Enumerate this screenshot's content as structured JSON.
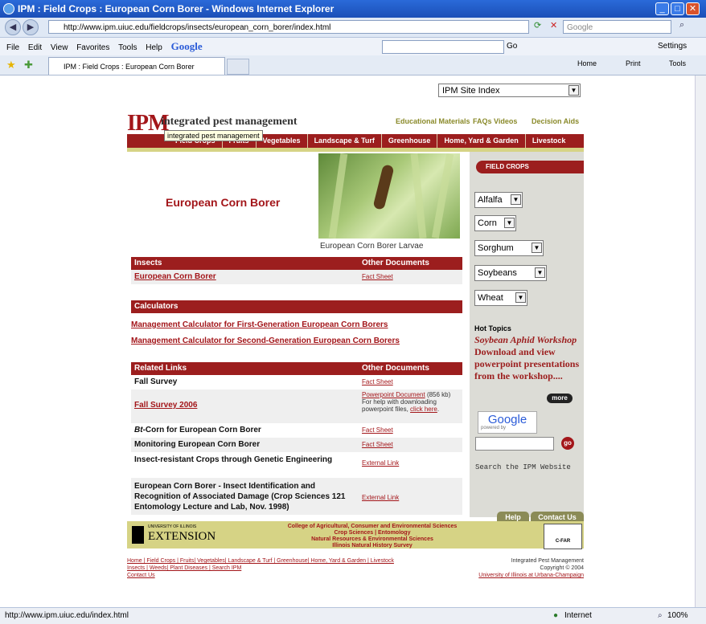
{
  "window": {
    "title": "IPM : Field Crops : European Corn Borer - Windows Internet Explorer"
  },
  "address": {
    "url": "http://www.ipm.uiuc.edu/fieldcrops/insects/european_corn_borer/index.html",
    "search_placeholder": "Google"
  },
  "menu": [
    "File",
    "Edit",
    "View",
    "Favorites",
    "Tools",
    "Help"
  ],
  "google_toolbar": {
    "label": "Google",
    "go": "Go"
  },
  "settings_label": "Settings",
  "tab": {
    "title": "IPM : Field Crops : European Corn Borer"
  },
  "tab_tools": [
    "Home",
    "Print",
    "Tools"
  ],
  "site_index": "IPM Site Index",
  "logo": {
    "mark": "IPM",
    "text": "integrated pest management"
  },
  "top_links": [
    "Educational Materials",
    "FAQs",
    "Videos",
    "Decision Aids"
  ],
  "nav_tabs": [
    "Field Crops",
    "Fruits",
    "Vegetables",
    "Landscape & Turf",
    "Greenhouse",
    "Home, Yard & Garden",
    "Livestock"
  ],
  "tooltip": "integrated pest management",
  "page_title": "European Corn Borer",
  "photo_caption": "European Corn Borer Larvae",
  "sidebar": {
    "banner": "FIELD CROPS",
    "crops": [
      "Alfalfa",
      "Corn",
      "Sorghum",
      "Soybeans",
      "Wheat"
    ],
    "hot_topics_title": "Hot Topics",
    "hot_topics_italic": "Soybean Aphid Workshop",
    "hot_topics_body": "Download and view powerpoint presentations from the workshop....",
    "more": "more",
    "google": "Google",
    "powered_by": "powered by",
    "go": "go",
    "search_label": "Search the IPM Website",
    "help": "Help",
    "contact": "Contact Us"
  },
  "insects_table": {
    "h1": "Insects",
    "h2": "Other Documents",
    "rows": [
      {
        "name": "European Corn Borer",
        "doc": "Fact Sheet"
      }
    ]
  },
  "calculators": {
    "title": "Calculators",
    "items": [
      "Management Calculator for First-Generation European Corn Borers",
      "Management Calculator for Second-Generation European Corn Borers"
    ]
  },
  "related": {
    "h1": "Related Links",
    "h2": "Other Documents",
    "rows": [
      {
        "name": "Fall Survey",
        "doc": "Fact Sheet"
      },
      {
        "name": "Fall Survey 2006",
        "doc": "Powerpoint Document",
        "doc_extra": " (856 kb)",
        "note": "For help with downloading powerpoint files,",
        "note_link": "click here",
        "note_end": "."
      },
      {
        "name_italic": "Bt",
        "name": "-Corn for European Corn Borer",
        "doc": "Fact Sheet"
      },
      {
        "name": "Monitoring European Corn Borer",
        "doc": "Fact Sheet"
      },
      {
        "name": "Insect-resistant Crops through Genetic Engineering",
        "doc": "External Link"
      },
      {
        "name": "European Corn Borer - Insect Identification and Recognition of Associated Damage (Crop Sciences 121 Entomology Lecture and Lab, Nov. 1998)",
        "doc": "External Link"
      }
    ]
  },
  "footer": {
    "ext_small": "UNIVERSITY OF ILLINOIS",
    "ext_big": "EXTENSION",
    "college": "College of Agricultural, Consumer and Environmental Sciences",
    "line2a": "Crop Sciences",
    "line2b": "Entomology",
    "line3": "Natural Resources & Environmental Sciences",
    "line4": "Illinois Natural History Survey",
    "cfar": "C-FAR",
    "bottom_links_1": "Home | Field Crops | Fruits| Vegetables| Landscape & Turf | Greenhouse| Home, Yard & Garden | Livestock",
    "bottom_links_2": "Insects | Weeds| Plant Diseases | Search IPM",
    "bottom_links_3": "Contact Us",
    "copy1": "Integrated Pest Management",
    "copy2": "Copyright © 2004",
    "copy3": "University of Illinois at Urbana-Champaign"
  },
  "status": {
    "url": "http://www.ipm.uiuc.edu/index.html",
    "zone": "Internet",
    "zoom": "100%"
  }
}
